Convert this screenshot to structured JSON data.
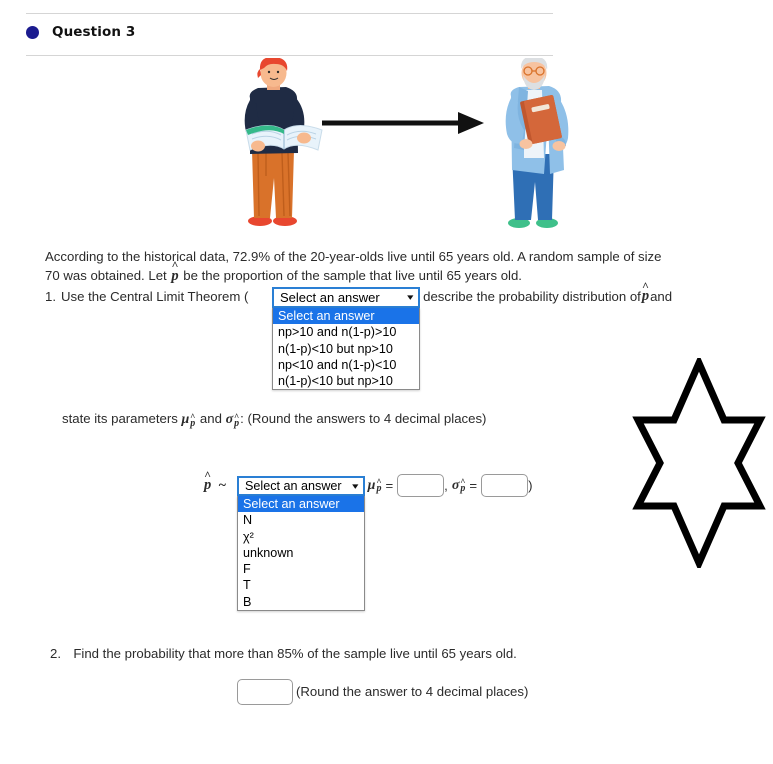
{
  "header": {
    "bullet_color": "#1b1b8f",
    "title": "Question 3"
  },
  "illustration": {
    "left_figure": "young-man-reading-book",
    "right_figure": "elderly-man-holding-folder",
    "connector": "right-arrow"
  },
  "intro": {
    "line1": "According to the historical data, 72.9% of the 20-year-olds live until 65 years old. A random sample of size",
    "line2_before_phat": "70 was obtained. Let ",
    "phat": "p",
    "line2_after_phat": " be the proportion of the sample that live until 65 years old."
  },
  "question1": {
    "number": "1.",
    "text_before_select": "Use the Central Limit Theorem (",
    "text_after_select": ") to describe the probability distribution of ",
    "text_tail": " and",
    "select": {
      "value": "Select an answer",
      "caret": "chevron-down-icon",
      "options": [
        "Select an answer",
        "np>10 and n(1-p)>10",
        "n(1-p)<10 but np>10",
        "np<10 and n(1-p)<10",
        "n(1-p)<10 but np>10"
      ],
      "selected_index": 0
    },
    "state_params": {
      "text_start": "state its parameters ",
      "mu_symbol": "μ",
      "and_text": " and ",
      "sigma_symbol": "σ",
      "text_end": ": (Round the answers to 4 decimal places)"
    },
    "distribution_row": {
      "phat": "p",
      "tilde": "~",
      "open_paren": "(",
      "mu_symbol": "μ",
      "equals": "=",
      "comma": ",",
      "sigma_symbol": "σ",
      "close_paren": ")",
      "mu_value": "",
      "sigma_value": "",
      "select": {
        "value": "Select an answer",
        "caret": "chevron-down-icon",
        "options": [
          "Select an answer",
          "N",
          "χ²",
          "unknown",
          "F",
          "T",
          "B"
        ],
        "selected_index": 0
      }
    }
  },
  "question2": {
    "number": "2.",
    "text": "Find the probability that more than 85% of the sample live until 65 years old.",
    "input_value": "",
    "note": "(Round the answer to 4 decimal places)"
  },
  "decoration": {
    "star": "six-pointed-star-outline"
  },
  "colors": {
    "bullet": "#1b1b8f",
    "select_focus_border": "#2a7fd4",
    "option_highlight": "#1a73e8",
    "rule": "#d5d5d5",
    "text": "#2b2b2b"
  }
}
